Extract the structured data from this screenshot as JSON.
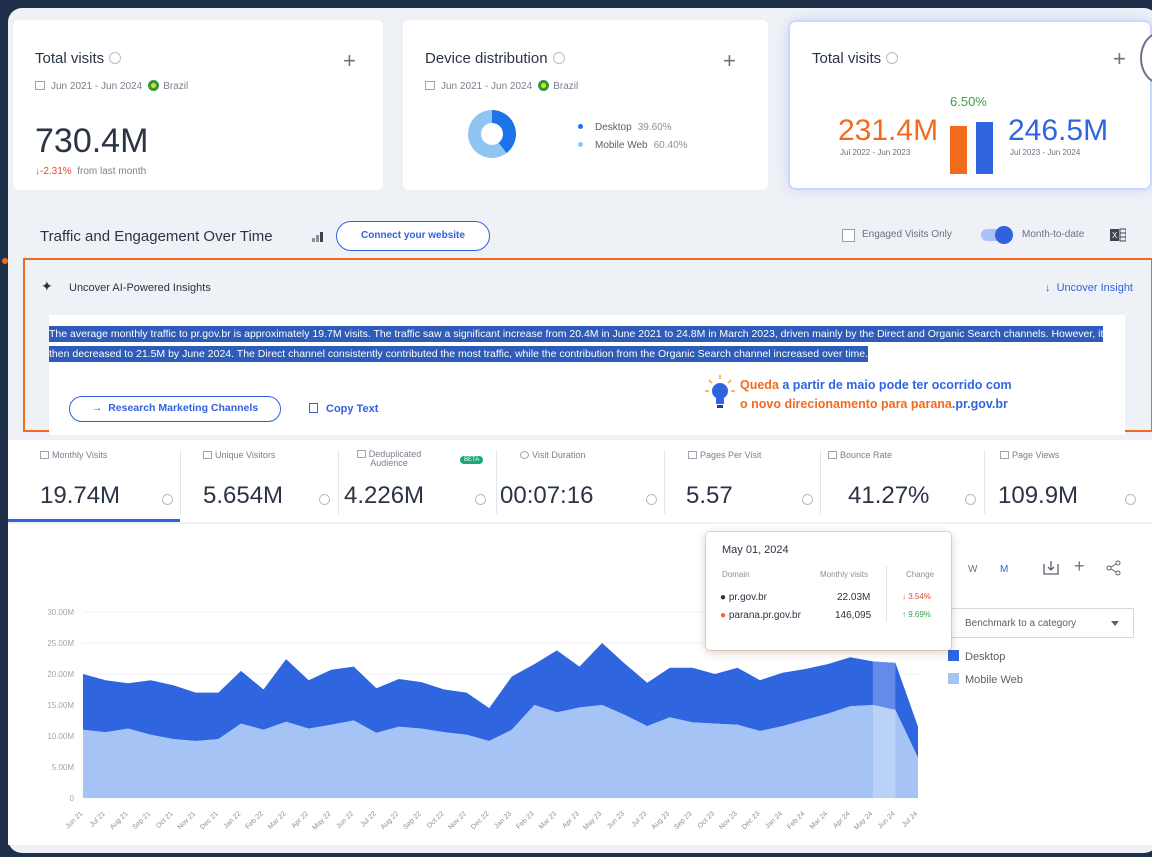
{
  "cards": {
    "total_visits": {
      "title": "Total visits",
      "date_range": "Jun 2021 - Jun 2024",
      "country": "Brazil",
      "value": "730.4M",
      "change_value": "-2.31%",
      "change_text": "from last month"
    },
    "device_distribution": {
      "title": "Device distribution",
      "date_range": "Jun 2021 - Jun 2024",
      "country": "Brazil",
      "desktop_label": "Desktop",
      "desktop_pct": "39.60%",
      "mobile_label": "Mobile Web",
      "mobile_pct": "60.40%",
      "desktop_share": 0.396,
      "desktop_color": "#1a73e8",
      "mobile_color": "#8fc4f3"
    },
    "comparison": {
      "title": "Total visits",
      "growth": "6.50%",
      "left_value": "231.4M",
      "left_period": "Jul 2022 - Jun 2023",
      "right_value": "246.5M",
      "right_period": "Jul 2023 - Jun 2024",
      "left_color": "#f26b1d",
      "right_color": "#2f66e0"
    }
  },
  "traffic": {
    "title": "Traffic and Engagement Over Time",
    "connect_label": "Connect your website",
    "engaged_label": "Engaged Visits Only",
    "mtd_label": "Month-to-date"
  },
  "ai": {
    "title": "Uncover AI-Powered Insights",
    "uncover_label": "Uncover Insight",
    "text": "The average monthly traffic to pr.gov.br is approximately 19.7M visits. The traffic saw a significant increase from 20.4M in June 2021 to 24.8M in March 2023, driven mainly by the Direct and Organic Search channels. However, it then decreased to 21.5M by June 2024. The Direct channel consistently contributed the most traffic, while the contribution from the Organic Search channel increased over time.",
    "research_label": "Research Marketing Channels",
    "copy_label": "Copy Text",
    "annotation_part1": "Queda",
    "annotation_part2": " a partir de maio pode ter ocorrido com",
    "annotation_part3": "o novo direcionamento para parana",
    "annotation_part4": ".pr.gov.br"
  },
  "metrics": [
    {
      "label": "Monthly Visits",
      "value": "19.74M"
    },
    {
      "label": "Unique Visitors",
      "value": "5.654M"
    },
    {
      "label": "Deduplicated Audience",
      "value": "4.226M",
      "badge": "BETA"
    },
    {
      "label": "Visit Duration",
      "value": "00:07:16"
    },
    {
      "label": "Pages Per Visit",
      "value": "5.57"
    },
    {
      "label": "Bounce Rate",
      "value": "41.27%"
    },
    {
      "label": "Page Views",
      "value": "109.9M"
    }
  ],
  "tooltip": {
    "date": "May 01, 2024",
    "col_domain": "Domain",
    "col_visits": "Monthly visits",
    "col_change": "Change",
    "rows": [
      {
        "domain": "pr.gov.br",
        "visits": "22.03M",
        "change": "↓ 3.54%",
        "dot": "#2b3444",
        "color": "#e5483a"
      },
      {
        "domain": "parana.pr.gov.br",
        "visits": "146,095",
        "change": "↑ 9.69%",
        "dot": "#f26b1d",
        "color": "#3ca049"
      }
    ]
  },
  "controls": {
    "week": "W",
    "month": "M",
    "benchmark": "Benchmark to a category"
  },
  "legend": {
    "desktop": "Desktop",
    "mobile": "Mobile Web"
  },
  "chart_data": {
    "type": "area",
    "stacked": true,
    "x": [
      "Jun 21",
      "Jul 21",
      "Aug 21",
      "Sep 21",
      "Oct 21",
      "Nov 21",
      "Dec 21",
      "Jan 22",
      "Feb 22",
      "Mar 22",
      "Apr 22",
      "May 22",
      "Jun 22",
      "Jul 22",
      "Aug 22",
      "Sep 22",
      "Oct 22",
      "Nov 22",
      "Dec 22",
      "Jan 23",
      "Feb 23",
      "Mar 23",
      "Apr 23",
      "May 23",
      "Jun 23",
      "Jul 23",
      "Aug 23",
      "Sep 23",
      "Oct 23",
      "Nov 23",
      "Dec 23",
      "Jan 24",
      "Feb 24",
      "Mar 24",
      "Apr 24",
      "May 24",
      "Jun 24",
      "Jul 24"
    ],
    "series": [
      {
        "name": "Mobile Web",
        "color": "#a5c3f5",
        "values": [
          11.0,
          10.6,
          11.2,
          10.2,
          9.5,
          9.2,
          9.5,
          12.0,
          11.0,
          12.3,
          11.2,
          11.8,
          12.5,
          10.5,
          11.5,
          11.2,
          10.6,
          10.2,
          9.2,
          11.0,
          15.0,
          13.8,
          14.6,
          15.0,
          13.4,
          11.6,
          13.0,
          12.2,
          12.0,
          11.8,
          10.8,
          11.6,
          12.6,
          13.6,
          14.8,
          15.0,
          14.2,
          6.5
        ]
      },
      {
        "name": "Desktop",
        "color": "#2f66e0",
        "values": [
          9.0,
          8.4,
          7.3,
          8.8,
          8.7,
          7.8,
          7.5,
          8.5,
          6.5,
          10.1,
          7.8,
          8.9,
          8.7,
          7.2,
          7.7,
          7.5,
          6.9,
          6.8,
          5.3,
          8.6,
          6.6,
          10.0,
          6.6,
          10.0,
          8.3,
          7.0,
          8.0,
          8.8,
          8.0,
          9.2,
          8.2,
          8.6,
          8.2,
          8.0,
          7.9,
          7.03,
          7.6,
          5.0
        ]
      }
    ],
    "ylim": [
      0,
      30
    ],
    "yticks": [
      "0",
      "5.00M",
      "10.00M",
      "15.00M",
      "20.00M",
      "25.00M",
      "30.00M"
    ],
    "grid": true,
    "legend": "right"
  }
}
